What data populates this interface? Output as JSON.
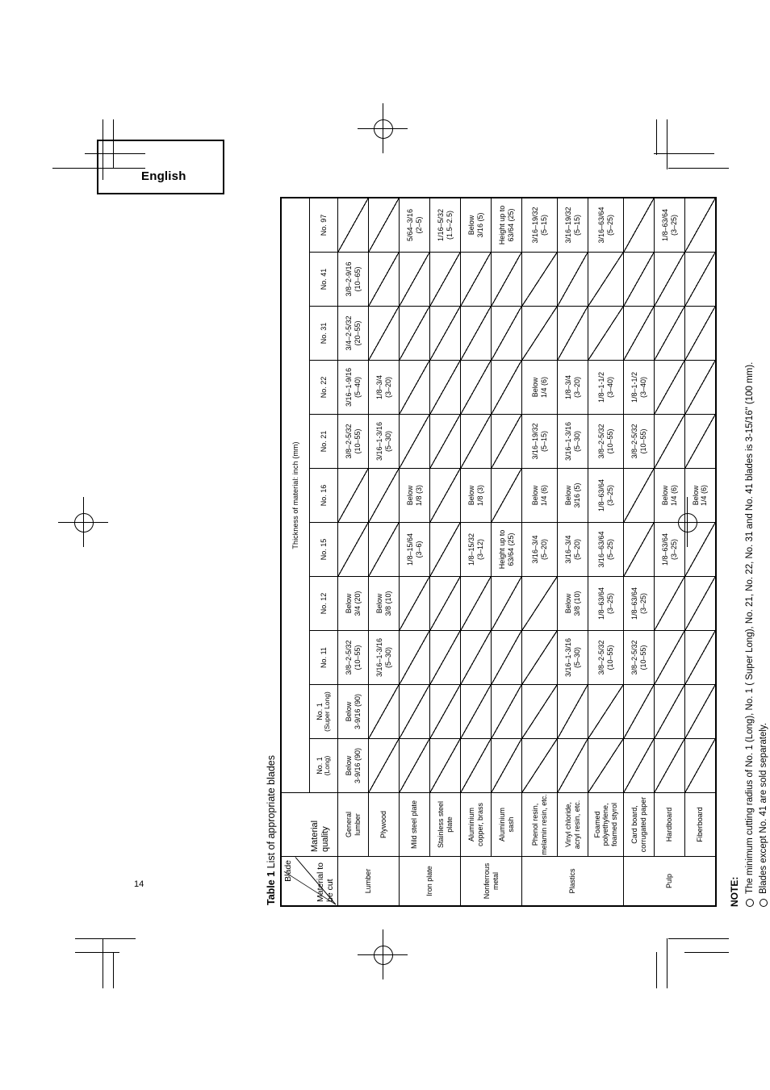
{
  "page": {
    "language_tab": "English",
    "page_number": "14"
  },
  "table": {
    "title_label": "Table 1",
    "title_text": "List of appropriate blades",
    "corner": {
      "blade_label": "Blade",
      "material_label": "Material\nto be cut",
      "quality_label": "Material\nquality"
    },
    "thickness_header": "Thickness of material: inch (mm)",
    "columns": [
      {
        "name": "No. 1",
        "sub": "(Long)"
      },
      {
        "name": "No. 1",
        "sub": "(Super Long)"
      },
      {
        "name": "No. 11",
        "sub": ""
      },
      {
        "name": "No. 12",
        "sub": ""
      },
      {
        "name": "No. 15",
        "sub": ""
      },
      {
        "name": "No. 16",
        "sub": ""
      },
      {
        "name": "No. 21",
        "sub": ""
      },
      {
        "name": "No. 22",
        "sub": ""
      },
      {
        "name": "No. 31",
        "sub": ""
      },
      {
        "name": "No. 41",
        "sub": ""
      },
      {
        "name": "No. 97",
        "sub": ""
      }
    ],
    "rows": [
      {
        "group": "Lumber",
        "group_rowspan": 2,
        "quality": "General\nlumber",
        "values": [
          "Below\n3-9/16 (90)",
          "Below\n3-9/16 (90)",
          "3/8–2-5/32\n(10–55)",
          "Below\n3/4 (20)",
          "",
          "",
          "3/8–2-5/32\n(10–55)",
          "3/16–1-9/16\n(5–40)",
          "3/4–2-5/32\n(20–55)",
          "3/8–2-9/16\n(10–65)",
          ""
        ]
      },
      {
        "group": "",
        "group_rowspan": 0,
        "quality": "Plywood",
        "values": [
          "",
          "",
          "3/16–1-3/16\n(5–30)",
          "Below\n3/8 (10)",
          "",
          "",
          "3/16–1-3/16\n(5–30)",
          "1/8–3/4\n(3–20)",
          "",
          "",
          ""
        ]
      },
      {
        "group": "Iron plate",
        "group_rowspan": 2,
        "quality": "Mild steel plate",
        "values": [
          "",
          "",
          "",
          "",
          "1/8–15/64\n(3–6)",
          "Below\n1/8 (3)",
          "",
          "",
          "",
          "",
          "5/64–3/16\n(2–5)"
        ]
      },
      {
        "group": "",
        "group_rowspan": 0,
        "quality": "Stainless steel\nplate",
        "values": [
          "",
          "",
          "",
          "",
          "",
          "",
          "",
          "",
          "",
          "",
          "1/16–5/32\n(1.5–2.5)"
        ]
      },
      {
        "group": "Nonferrous\nmetal",
        "group_rowspan": 2,
        "quality": "Aluminium\ncopper, brass",
        "values": [
          "",
          "",
          "",
          "",
          "1/8–15/32\n(3–12)",
          "Below\n1/8 (3)",
          "",
          "",
          "",
          "",
          "Below\n3/16 (5)"
        ]
      },
      {
        "group": "",
        "group_rowspan": 0,
        "quality": "Aluminium\nsash",
        "values": [
          "",
          "",
          "",
          "",
          "Height up to\n63/64 (25)",
          "",
          "",
          "",
          "",
          "",
          "Height up to\n63/64 (25)"
        ]
      },
      {
        "group": "Plastics",
        "group_rowspan": 3,
        "quality": "Phenol resin,\nmelamin resin, etc.",
        "quality_small": true,
        "values": [
          "",
          "",
          "",
          "",
          "3/16–3/4\n(5–20)",
          "Below\n1/4 (6)",
          "3/16–19/32\n(5–15)",
          "Below\n1/4 (6)",
          "",
          "",
          "3/16–19/32\n(5–15)"
        ]
      },
      {
        "group": "",
        "group_rowspan": 0,
        "quality": "Vinyl chloride,\nacryl resin, etc.",
        "values": [
          "",
          "",
          "3/16–1-3/16\n(5–30)",
          "Below\n3/8 (10)",
          "3/16–3/4\n(5–20)",
          "Below\n3/16 (5)",
          "3/16–1-3/16\n(5–30)",
          "1/8–3/4\n(3–20)",
          "",
          "",
          "3/16–19/32\n(5–15)"
        ]
      },
      {
        "group": "",
        "group_rowspan": 0,
        "quality": "Foamed polyethylene,\nfoamed styrol",
        "quality_small": true,
        "values": [
          "",
          "",
          "3/8–2-5/32\n(10–55)",
          "1/8–63/64\n(3–25)",
          "3/16–63/64\n(5–25)",
          "1/8–63/64\n(3–25)",
          "3/8–2-5/32\n(10–55)",
          "1/8–1-1/2\n(3–40)",
          "",
          "",
          "3/16–63/64\n(5–25)"
        ]
      },
      {
        "group": "Pulp",
        "group_rowspan": 3,
        "quality": "Card board,\ncorrugated paper",
        "values": [
          "",
          "",
          "3/8–2-5/32\n(10–55)",
          "1/8–63/64\n(3–25)",
          "",
          "",
          "3/8–2-5/32\n(10–55)",
          "1/8–1-1/2\n(3–40)",
          "",
          "",
          ""
        ]
      },
      {
        "group": "",
        "group_rowspan": 0,
        "quality": "Hardboard",
        "values": [
          "",
          "",
          "",
          "",
          "1/8–63/64\n(3–25)",
          "Below\n1/4 (6)",
          "",
          "",
          "",
          "",
          "1/8–63/64\n(3–25)"
        ]
      },
      {
        "group": "",
        "group_rowspan": 0,
        "quality": "Fiberboard",
        "values": [
          "",
          "",
          "",
          "",
          "",
          "Below\n1/4 (6)",
          "",
          "",
          "",
          "",
          ""
        ]
      }
    ]
  },
  "note": {
    "title": "NOTE:",
    "items": [
      "The minimum cutting radius of No. 1 (Long), No. 1 ( Super Long), No. 21, No. 22, No. 31 and No. 41 blades is 3-15/16\" (100 mm).",
      "Blades except No. 41 are sold separately."
    ]
  }
}
